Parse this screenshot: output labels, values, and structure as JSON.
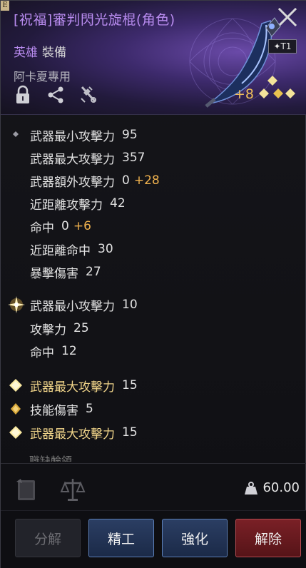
{
  "header": {
    "corner_tag": "E",
    "title": "[祝福]審判閃光旋棍(角色)",
    "rarity": "英雄",
    "type": "裝備",
    "exclusive": "阿卡夏專用",
    "tier": "✦T1",
    "enhance": "+8",
    "icons": [
      "lock-icon",
      "share-icon",
      "tool-icon"
    ]
  },
  "stats": {
    "base": [
      {
        "label": "武器最小攻擊力",
        "value": "95",
        "bonus": ""
      },
      {
        "label": "武器最大攻擊力",
        "value": "357",
        "bonus": ""
      },
      {
        "label": "武器額外攻擊力",
        "value": "0",
        "bonus": "+28"
      },
      {
        "label": "近距離攻擊力",
        "value": "42",
        "bonus": ""
      },
      {
        "label": "命中",
        "value": "0",
        "bonus": "+6"
      },
      {
        "label": "近距離命中",
        "value": "30",
        "bonus": ""
      },
      {
        "label": "暴擊傷害",
        "value": "27",
        "bonus": ""
      }
    ],
    "blessing": [
      {
        "label": "武器最小攻擊力",
        "value": "10"
      },
      {
        "label": "攻擊力",
        "value": "25"
      },
      {
        "label": "命中",
        "value": "12"
      }
    ],
    "options": [
      {
        "label": "武器最大攻擊力",
        "value": "15"
      },
      {
        "label": "技能傷害",
        "value": "5"
      },
      {
        "label": "武器最大攻擊力",
        "value": "15"
      }
    ]
  },
  "cut_text": "職缺輪領",
  "footer": {
    "weight": "60.00",
    "icons": [
      "book-icon",
      "scale-icon",
      "weight-icon"
    ]
  },
  "buttons": {
    "dismantle": "分解",
    "refine": "精工",
    "enhance": "強化",
    "remove": "解除"
  },
  "colors": {
    "title": "#b98cf0",
    "bonus": "#f0b24e",
    "option_label": "#f1d58a",
    "refine": "#2b3e63",
    "remove": "#7a2026"
  }
}
